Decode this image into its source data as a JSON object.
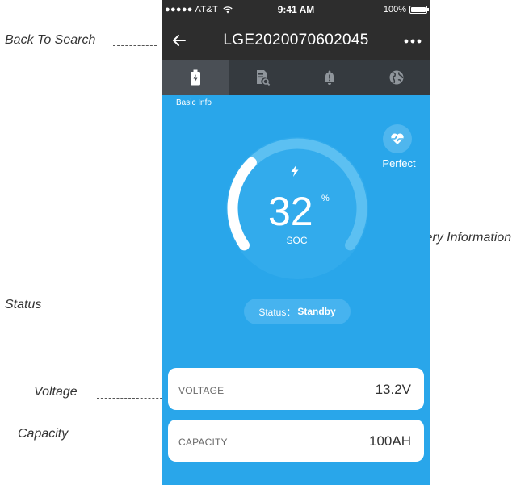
{
  "annotations": {
    "back_to_search": "Back To Search",
    "battery_information": "Battery Information",
    "status": "Status",
    "voltage": "Voltage",
    "capacity": "Capacity"
  },
  "status_bar": {
    "carrier": "●●●●● AT&T",
    "time": "9:41 AM",
    "battery": "100%"
  },
  "nav": {
    "title": "LGE2020070602045",
    "back_icon": "arrow-left-icon",
    "more_icon": "more-dots-icon"
  },
  "tabs": [
    {
      "icon": "battery-icon",
      "label": "Basic Info",
      "active": true
    },
    {
      "icon": "report-search-icon",
      "active": false
    },
    {
      "icon": "alarm-bell-icon",
      "active": false
    },
    {
      "icon": "globe-icon",
      "active": false
    }
  ],
  "battery": {
    "soc": "32",
    "soc_fraction": 0.32,
    "soc_unit": "%",
    "soc_label": "SOC",
    "health": "Perfect",
    "status_label": "Status：",
    "status_value": "Standby"
  },
  "metrics": [
    {
      "label": "VOLTAGE",
      "value": "13.2V"
    },
    {
      "label": "CAPACITY",
      "value": "100AH"
    }
  ],
  "colors": {
    "primary": "#29a6ea",
    "nav": "#2d2d2d",
    "tabbar": "#353a3f"
  }
}
